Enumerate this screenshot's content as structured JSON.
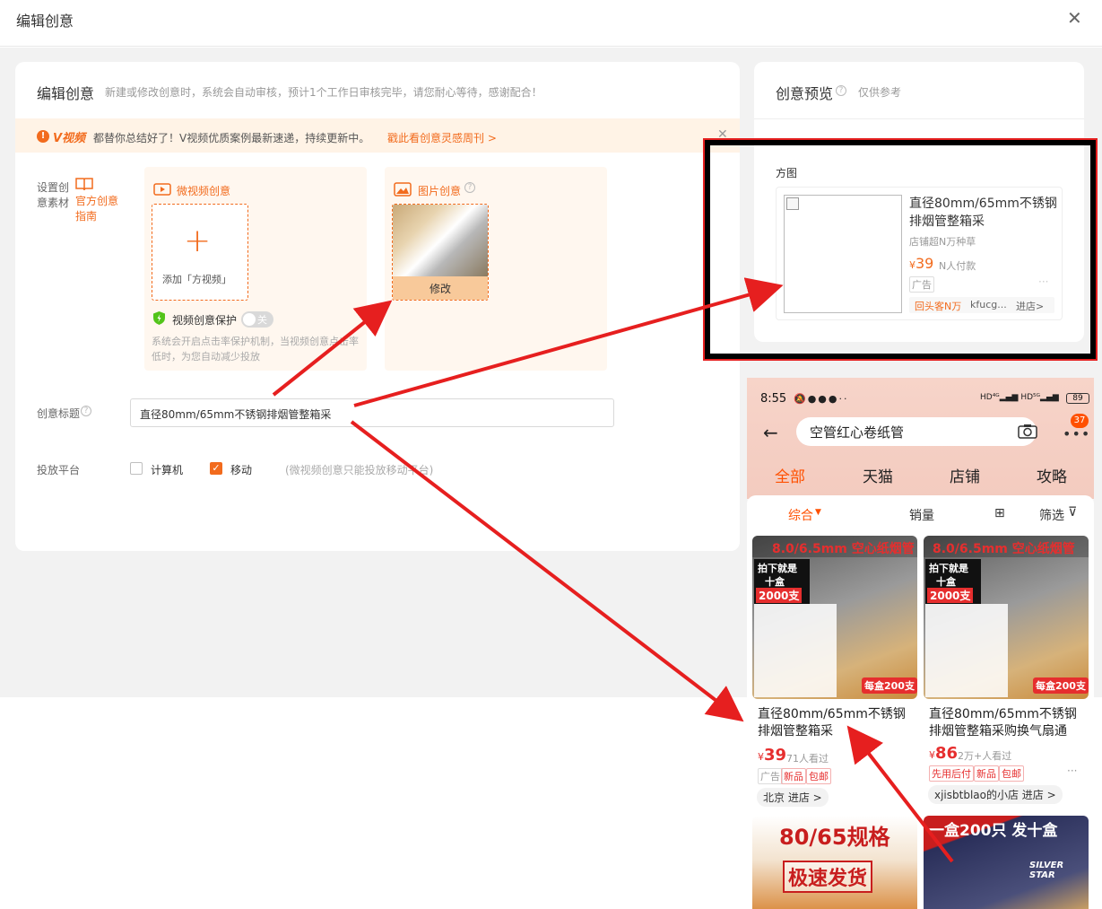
{
  "dialog": {
    "title": "编辑创意"
  },
  "editor": {
    "title": "编辑创意",
    "subtitle": "新建或修改创意时，系统会自动审核，预计1个工作日审核完毕，请您耐心等待，感谢配合！",
    "banner": {
      "brand": "V视频",
      "text": "都替你总结好了！V视频优质案例最新速递，持续更新中。",
      "link": "戳此看创意灵感周刊 >"
    },
    "material": {
      "label": "设置创意素材",
      "guide": "官方创意指南",
      "video": {
        "title": "微视频创意",
        "add_label": "添加「方视频」",
        "protect_label": "视频创意保护",
        "toggle_text": "关",
        "protect_desc": "系统会开启点击率保护机制，当视频创意点击率低时，为您自动减少投放"
      },
      "image": {
        "title": "图片创意",
        "modify_label": "修改"
      }
    },
    "creative_title": {
      "label": "创意标题",
      "value": "直径80mm/65mm不锈钢排烟管整箱采"
    },
    "platform": {
      "label": "投放平台",
      "options": [
        {
          "label": "计算机",
          "checked": false
        },
        {
          "label": "移动",
          "checked": true
        }
      ],
      "note": "(微视频创意只能投放移动平台)"
    }
  },
  "preview": {
    "title": "创意预览",
    "hint": "仅供参考",
    "section": "方图",
    "card": {
      "title": "直径80mm/65mm不锈钢排烟管整箱采",
      "shop_line": "店铺超N万种草",
      "price": "39",
      "price_note": "N人付款",
      "ad_tag": "广告",
      "promo": "回头客N万",
      "shop_name": "kfucg...",
      "enter": "进店>"
    }
  },
  "phone": {
    "time": "8:55",
    "battery": "89",
    "search_text": "空管红心卷纸管",
    "cart_badge": "37",
    "tabs": [
      "全部",
      "天猫",
      "店铺",
      "攻略"
    ],
    "sorts": {
      "comprehensive": "综合",
      "sales": "销量",
      "filter": "筛选"
    },
    "products": [
      {
        "img_headline": "8.0/6.5mm 空心纸烟管",
        "img_tag1": "拍下就是",
        "img_tag2": "十盒",
        "img_tag3": "2000支",
        "img_corner": "每盒200支",
        "title": "直径80mm/65mm不锈钢排烟管整箱采",
        "price": "39",
        "note": "71人看过",
        "badges": [
          "广告",
          "新品",
          "包邮"
        ],
        "location": "北京 进店 >"
      },
      {
        "img_headline": "8.0/6.5mm 空心纸烟管",
        "img_tag1": "拍下就是",
        "img_tag2": "十盒",
        "img_tag3": "2000支",
        "img_corner": "每盒200支",
        "title": "直径80mm/65mm不锈钢排烟管整箱采购换气扇通",
        "price": "86",
        "note": "2万+人看过",
        "badges": [
          "先用后付",
          "新品",
          "包邮"
        ],
        "location": "xjisbtblao的小店 进店 >"
      }
    ],
    "bottom_left": {
      "headline": "80/65规格",
      "stamp": "极速发货"
    },
    "bottom_right": {
      "headline": "一盒200只 发十盒",
      "brand": "SILVER STAR"
    }
  },
  "colors": {
    "accent": "#f26b1d",
    "annotation": "#e61f1f",
    "price": "#e62e2e"
  }
}
